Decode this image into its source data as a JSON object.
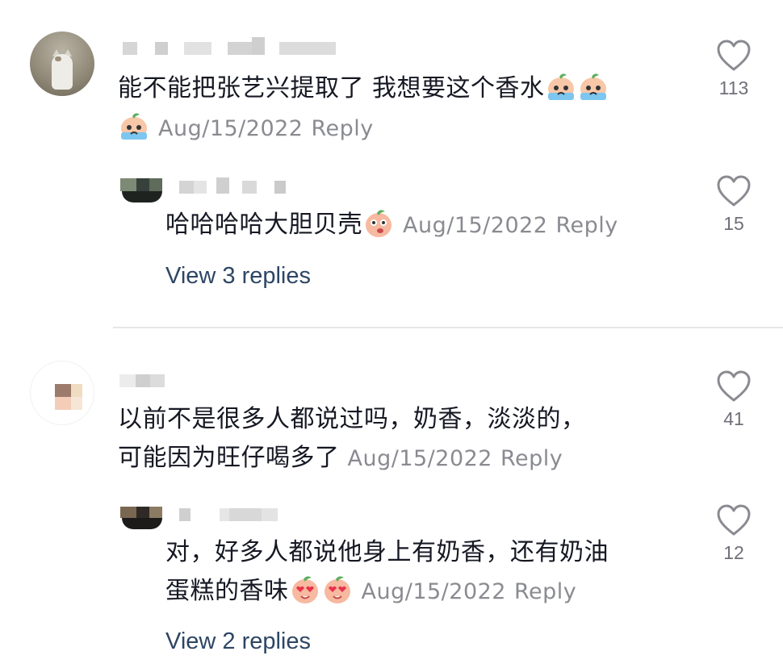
{
  "comments": [
    {
      "text": "能不能把张艺兴提取了 我想要这个香水",
      "date": "Aug/15/2022",
      "reply_label": "Reply",
      "likes": "113",
      "replies": [
        {
          "text": "哈哈哈哈大胆贝壳",
          "date": "Aug/15/2022",
          "reply_label": "Reply",
          "likes": "15"
        }
      ],
      "view_replies": "View 3 replies"
    },
    {
      "text_line1": "以前不是很多人都说过吗，奶香，淡淡的，",
      "text_line2": "可能因为旺仔喝多了",
      "date": "Aug/15/2022",
      "reply_label": "Reply",
      "likes": "41",
      "replies": [
        {
          "text_line1": "对，好多人都说他身上有奶香，还有奶油",
          "text_line2": "蛋糕的香味",
          "date": "Aug/15/2022",
          "reply_label": "Reply",
          "likes": "12"
        }
      ],
      "view_replies": "View 2 replies"
    }
  ],
  "icons": {
    "like": "heart-outline-icon",
    "crying_emoji": "crying-peach-sticker",
    "peach_emoji": "peach-face-sticker",
    "heart_eyes_emoji": "heart-eyes-peach-sticker"
  },
  "colors": {
    "text": "#161823",
    "meta": "#8a8b91",
    "link": "#2d4664",
    "divider": "#e6e6e8"
  }
}
